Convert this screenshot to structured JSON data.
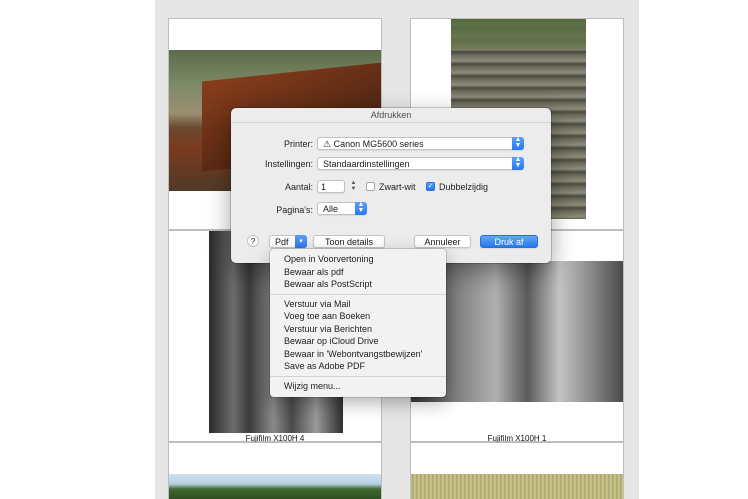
{
  "pages": {
    "captions": [
      "Fujifilm X100H 4",
      "Fujifilm X100H 1"
    ]
  },
  "dialog": {
    "title": "Afdrukken",
    "printer_label": "Printer:",
    "printer_value": "⚠ Canon MG5600 series",
    "settings_label": "Instellingen:",
    "settings_value": "Standaardinstellingen",
    "copies_label": "Aantal:",
    "copies_value": "1",
    "bw_label": "Zwart-wit",
    "duplex_label": "Dubbelzijdig",
    "pages_label": "Pagina's:",
    "pages_value": "Alle",
    "help_label": "?",
    "pdf_label": "Pdf",
    "details_label": "Toon details",
    "cancel_label": "Annuleer",
    "print_label": "Druk af"
  },
  "pdf_menu": {
    "group1": [
      "Open in Voorvertoning",
      "Bewaar als pdf",
      "Bewaar als PostScript"
    ],
    "group2": [
      "Verstuur via Mail",
      "Voeg toe aan Boeken",
      "Verstuur via Berichten",
      "Bewaar op iCloud Drive",
      "Bewaar in 'Webontvangstbewijzen'",
      "Save as Adobe PDF"
    ],
    "group3": [
      "Wijzig menu..."
    ]
  },
  "colors": {
    "accent": "#2a77ef",
    "dialog_bg": "#ececec"
  }
}
